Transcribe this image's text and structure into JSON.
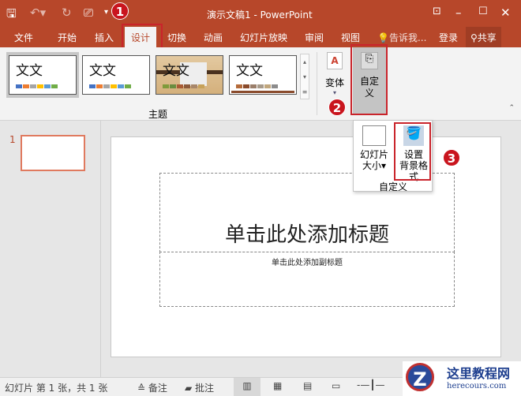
{
  "window": {
    "title": "演示文稿1 - PowerPoint"
  },
  "tabs": [
    "文件",
    "开始",
    "插入",
    "设计",
    "切换",
    "动画",
    "幻灯片放映",
    "审阅",
    "视图"
  ],
  "tell_me": "告诉我...",
  "login": "登录",
  "share": "共享",
  "themes": {
    "group_label": "主题",
    "items": [
      {
        "label": "文文",
        "colors": [
          "#4472c4",
          "#ed7d31",
          "#a5a5a5",
          "#ffc000",
          "#5b9bd5",
          "#70ad47"
        ]
      },
      {
        "label": "文文",
        "colors": [
          "#4472c4",
          "#ed7d31",
          "#a5a5a5",
          "#ffc000",
          "#5b9bd5",
          "#70ad47"
        ]
      },
      {
        "label": "文文",
        "colors": [
          "#7f9a3b",
          "#6a8d3f",
          "#a95b35",
          "#8c5a3c",
          "#a8876a",
          "#c7a25a"
        ]
      },
      {
        "label": "文文",
        "colors": [
          "#b46a3a",
          "#8a4b2c",
          "#9a7e6a",
          "#a79a8a",
          "#c1a77d",
          "#8c8c8c"
        ]
      }
    ]
  },
  "variants": {
    "label": "变体"
  },
  "customize": {
    "label": "自定义",
    "popup": {
      "slide_size": "幻灯片\n大小",
      "format_bg_1": "设置",
      "format_bg_2": "背景格式",
      "group_label": "自定义",
      "slide_size_1": "幻灯片",
      "slide_size_2": "大小"
    }
  },
  "annotations": [
    "1",
    "2",
    "3"
  ],
  "thumbnails": [
    {
      "number": "1"
    }
  ],
  "slide": {
    "title_placeholder": "单击此处添加标题",
    "subtitle_placeholder": "单击此处添加副标题"
  },
  "status": {
    "slide_info": "幻灯片 第 1 张，共 1 张",
    "notes": "备注",
    "comments": "批注"
  },
  "watermark": {
    "name": "这里教程网",
    "url": "herecours.com"
  },
  "colors": {
    "accent": "#b7472a",
    "annotation": "#c9151e"
  }
}
